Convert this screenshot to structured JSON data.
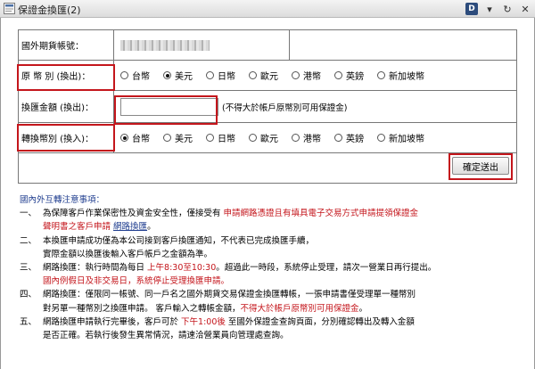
{
  "window": {
    "title": "保證金換匯(2)"
  },
  "title_controls": [
    "D",
    "▾",
    "↻",
    "✕"
  ],
  "form": {
    "account_label": "國外期貨帳號：",
    "from_currency_label": "原 幣 別 (換出)：",
    "amount_label": "換匯金額 (換出)：",
    "amount_value": "",
    "amount_hint": "(不得大於帳戶原幣別可用保證金)",
    "to_currency_label": "轉換幣別 (換入)：",
    "currencies": [
      "台幣",
      "美元",
      "日幣",
      "歐元",
      "港幣",
      "英鎊",
      "新加坡幣"
    ],
    "from_selected": "美元",
    "to_selected": "台幣",
    "submit_label": "確定送出"
  },
  "notes": {
    "title": "國內外互轉注意事項：",
    "items": [
      {
        "idx": "一、",
        "lines": [
          [
            {
              "t": "為保障客戶作業保密性及資金安全性，僅接受有 "
            },
            {
              "t": "申請網路憑證且有填具電子交易方式申請提領保證金",
              "c": "red"
            }
          ],
          [
            {
              "t": "聲明書之客戶申請",
              "c": "red"
            },
            {
              "t": "   "
            },
            {
              "t": "網路換匯",
              "c": "link"
            },
            {
              "t": "。"
            }
          ]
        ]
      },
      {
        "idx": "二、",
        "lines": [
          [
            {
              "t": "本換匯申請成功僅為本公司接到客戶換匯通知，不代表已完成換匯手續，"
            }
          ],
          [
            {
              "t": "實際金額以換匯後輸入客戶帳戶之金額為準。"
            }
          ]
        ]
      },
      {
        "idx": "三、",
        "lines": [
          [
            {
              "t": "網路換匯：執行時間為每日 "
            },
            {
              "t": "上午8:30至10:30",
              "c": "red"
            },
            {
              "t": "。超過此一時段，系統停止受理，請次一營業日再行提出。"
            }
          ],
          [
            {
              "t": "國內例假日及非交易日，系統停止受理換匯申請。",
              "c": "red"
            }
          ]
        ]
      },
      {
        "idx": "四、",
        "lines": [
          [
            {
              "t": "網路換匯：僅限同一帳號、同一戶名之國外期貨交易保證金換匯轉帳，一張申請書僅受理單一種幣別"
            }
          ],
          [
            {
              "t": "對另單一種幣別之換匯申請。 客戶輸入之轉帳金額，"
            },
            {
              "t": "不得大於帳戶原幣別可用保證金",
              "c": "red"
            },
            {
              "t": "。"
            }
          ]
        ]
      },
      {
        "idx": "五、",
        "lines": [
          [
            {
              "t": "網路換匯申請執行完畢後，客戶可於 "
            },
            {
              "t": "下午1:00後",
              "c": "red"
            },
            {
              "t": " 至國外保證金查詢頁面，分別確認轉出及轉入金額"
            }
          ],
          [
            {
              "t": "是否正確。若執行後發生異常情況，請速洽營業員向管理處查詢。"
            }
          ]
        ]
      }
    ]
  }
}
